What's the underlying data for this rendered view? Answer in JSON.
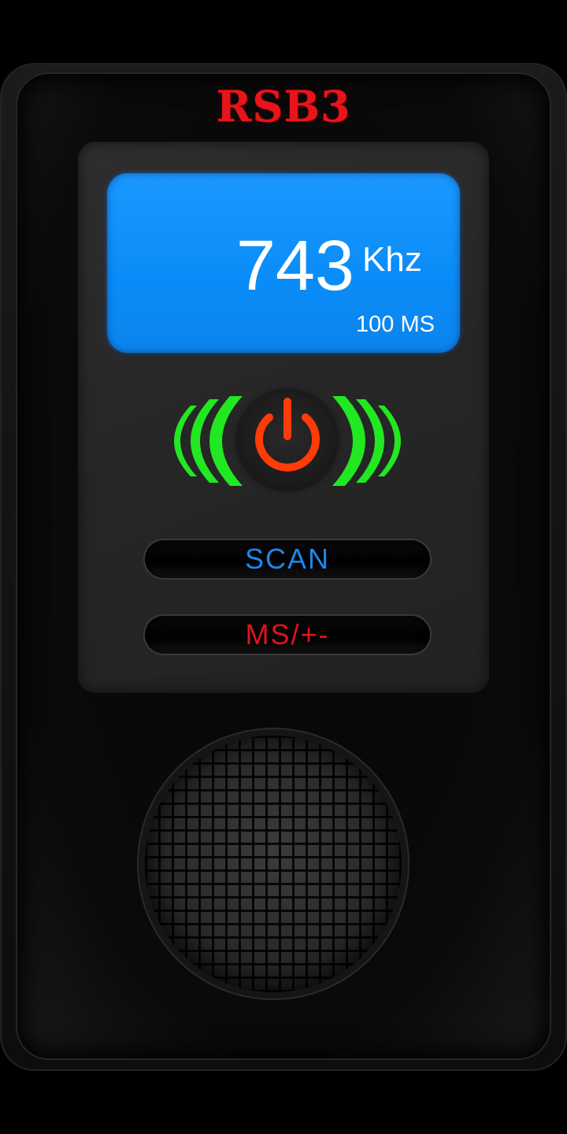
{
  "brand": {
    "title": "RSB3"
  },
  "display": {
    "frequency": "743",
    "unit": "Khz",
    "sweep": "100 MS"
  },
  "controls": {
    "scan_label": "SCAN",
    "ms_label": "MS/+-"
  },
  "colors": {
    "brand": "#e8141c",
    "lcd": "#0a8cf8",
    "wave": "#22e822",
    "power": "#ff3b0a",
    "scan": "#1d86ee",
    "ms": "#e0141a"
  },
  "icons": {
    "power": "power-icon",
    "waves": "signal-waves-icon",
    "speaker": "speaker-grille-icon"
  }
}
